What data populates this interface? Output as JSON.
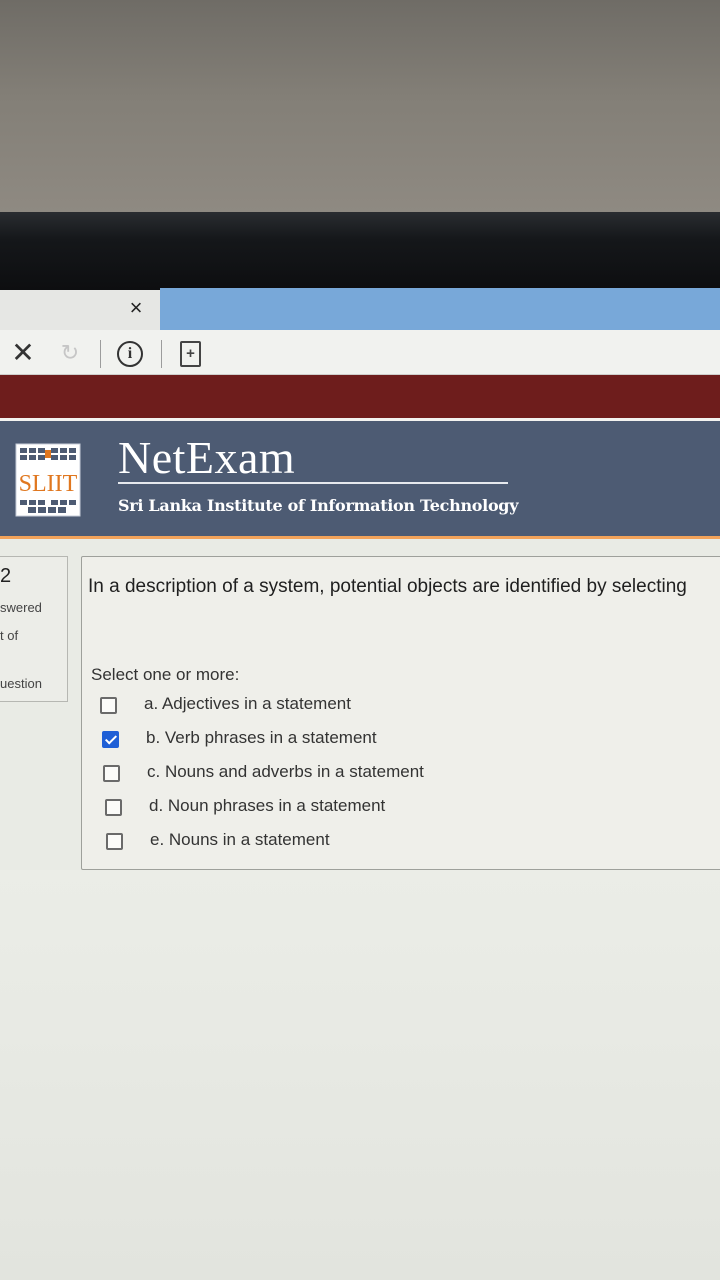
{
  "browser": {
    "tab_close_glyph": "×",
    "stop_glyph": "✕",
    "reload_glyph": "↻",
    "info_glyph": "i",
    "page_glyph": "+",
    "active_tab_color": "#e6e7e4",
    "other_tab_color": "#78a8d9"
  },
  "header": {
    "logo_text": "SLIIT",
    "title": "NetExam",
    "institution": "Sri Lanka Institute of Information Technology",
    "top_bar_color": "#6e1d1c",
    "brand_bar_color": "#4d5b73",
    "accent_line_color": "#f3a35a"
  },
  "question_info": {
    "number": "2",
    "status": "swered",
    "marks": "t of",
    "flag": "uestion"
  },
  "question": {
    "text": "In a description of a system,  potential objects are identified by selecting",
    "prompt": "Select one or more:",
    "answers": [
      {
        "label": "a. Adjectives in a statement",
        "checked": false
      },
      {
        "label": "b. Verb phrases in a statement",
        "checked": true
      },
      {
        "label": "c. Nouns and adverbs in a statement",
        "checked": false
      },
      {
        "label": "d. Noun phrases in a statement",
        "checked": false
      },
      {
        "label": "e. Nouns in a statement",
        "checked": false
      }
    ]
  }
}
